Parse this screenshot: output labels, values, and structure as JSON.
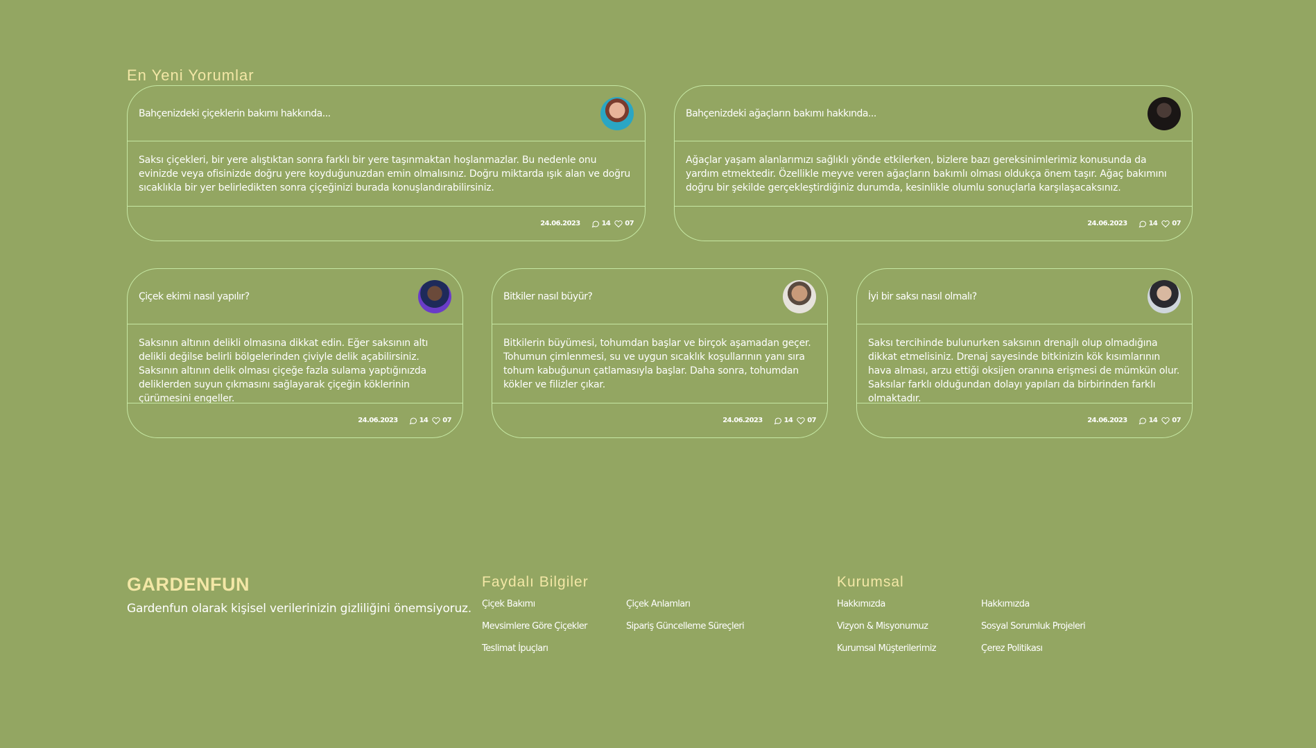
{
  "comments_section": {
    "title": "En Yeni Yorumlar",
    "cards": [
      {
        "title": "Bahçenizdeki çiçeklerin bakımı hakkında...",
        "body": "Saksı çiçekleri, bir yere alıştıktan sonra farklı bir yere taşınmaktan hoşlanmazlar. Bu nedenle onu evinizde veya ofisinizde doğru yere koyduğunuzdan emin olmalısınız. Doğru miktarda ışık alan ve doğru sıcaklıkla bir yer belirledikten sonra çiçeğinizi burada konuşlandırabilirsiniz.",
        "date": "24.06.2023",
        "comments": "14",
        "likes": "07"
      },
      {
        "title": "Bahçenizdeki ağaçların bakımı hakkında...",
        "body": "Ağaçlar yaşam alanlarımızı sağlıklı yönde etkilerken, bizlere bazı gereksinimlerimiz konusunda da yardım etmektedir. Özellikle meyve veren ağaçların bakımlı olması oldukça önem taşır. Ağaç bakımını doğru bir şekilde gerçekleştirdiğiniz durumda, kesinlikle olumlu sonuçlarla karşılaşacaksınız.",
        "date": "24.06.2023",
        "comments": "14",
        "likes": "07"
      },
      {
        "title": "Çiçek ekimi nasıl yapılır?",
        "body": "Saksının altının delikli olmasına dikkat edin. Eğer saksının altı delikli değilse belirli bölgelerinden çiviyle delik açabilirsiniz. Saksının altının delik olması çiçeğe fazla sulama yaptığınızda deliklerden suyun çıkmasını sağlayarak çiçeğin köklerinin çürümesini engeller.",
        "date": "24.06.2023",
        "comments": "14",
        "likes": "07"
      },
      {
        "title": "Bitkiler nasıl büyür?",
        "body": "Bitkilerin büyümesi, tohumdan başlar ve birçok aşamadan geçer. Tohumun çimlenmesi, su ve uygun sıcaklık koşullarının yanı sıra tohum kabuğunun çatlamasıyla başlar. Daha sonra, tohumdan kökler ve filizler çıkar.",
        "date": "24.06.2023",
        "comments": "14",
        "likes": "07"
      },
      {
        "title": "İyi bir saksı nasıl olmalı?",
        "body": "Saksı tercihinde bulunurken saksının drenajlı olup olmadığına dikkat etmelisiniz. Drenaj sayesinde bitkinizin kök kısımlarının hava alması, arzu ettiği oksijen oranına erişmesi de mümkün olur. Saksılar farklı olduğundan dolayı yapıları da birbirinden farklı olmaktadır.",
        "date": "24.06.2023",
        "comments": "14",
        "likes": "07"
      }
    ]
  },
  "footer": {
    "brand": "GARDENFUN",
    "description": "Gardenfun olarak kişisel verilerinizin gizliliğini önemsiyoruz.",
    "faydali": {
      "title": "Faydalı Bilgiler",
      "links": [
        "Çiçek Bakımı",
        "Çiçek Anlamları",
        "Mevsimlere Göre Çiçekler",
        "Sipariş Güncelleme Süreçleri",
        "Teslimat İpuçları"
      ]
    },
    "kurumsal": {
      "title": "Kurumsal",
      "links": [
        "Hakkımızda",
        "Hakkımızda",
        "Vizyon & Misyonumuz",
        "Sosyal Sorumluk Projeleri",
        "Kurumsal Müşterilerimiz",
        "Çerez Politikası"
      ]
    }
  },
  "colors": {
    "background": "#93a662",
    "accent_text": "#f3e7a6",
    "card_border": "#c6e8a4"
  },
  "icons": [
    "comment-icon",
    "heart-icon"
  ]
}
